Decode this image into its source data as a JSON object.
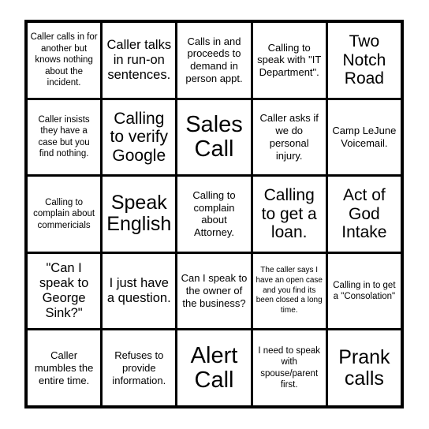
{
  "card": {
    "type": "bingo-card",
    "columns": 5,
    "rows": 5,
    "border_color": "#000000",
    "cell_background": "#ffffff",
    "text_color": "#000000",
    "cells": [
      {
        "text": "Caller calls in for another but knows nothing about the incident.",
        "size": "fs-sm"
      },
      {
        "text": "Caller talks in run-on sentences.",
        "size": "fs-lg"
      },
      {
        "text": "Calls in and proceeds to demand in person appt.",
        "size": "fs-md"
      },
      {
        "text": "Calling to speak with \"IT Department\".",
        "size": "fs-md"
      },
      {
        "text": "Two Notch Road",
        "size": "fs-xl"
      },
      {
        "text": "Caller insists they have a case but you find nothing.",
        "size": "fs-sm"
      },
      {
        "text": "Calling to verify Google",
        "size": "fs-xl"
      },
      {
        "text": "Sales Call",
        "size": "fs-max"
      },
      {
        "text": "Caller asks if we do personal injury.",
        "size": "fs-md"
      },
      {
        "text": "Camp LeJune Voicemail.",
        "size": "fs-md"
      },
      {
        "text": "Calling to complain about commericials",
        "size": "fs-sm"
      },
      {
        "text": "Speak English",
        "size": "fs-xxl"
      },
      {
        "text": "Calling to complain about Attorney.",
        "size": "fs-md"
      },
      {
        "text": "Calling to get a loan.",
        "size": "fs-xl"
      },
      {
        "text": "Act of God Intake",
        "size": "fs-xl"
      },
      {
        "text": "\"Can I speak to George Sink?\"",
        "size": "fs-lg"
      },
      {
        "text": "I just have a question.",
        "size": "fs-lg"
      },
      {
        "text": "Can I speak to the owner of the business?",
        "size": "fs-md"
      },
      {
        "text": "The caller says I have an open case and you find its been closed a long time.",
        "size": "fs-xs"
      },
      {
        "text": "Calling in to get a \"Consolation\"",
        "size": "fs-sm"
      },
      {
        "text": "Caller mumbles the entire time.",
        "size": "fs-md"
      },
      {
        "text": "Refuses to provide information.",
        "size": "fs-md"
      },
      {
        "text": "Alert Call",
        "size": "fs-max"
      },
      {
        "text": "I need to speak with spouse/parent first.",
        "size": "fs-sm"
      },
      {
        "text": "Prank calls",
        "size": "fs-xxl"
      }
    ]
  }
}
